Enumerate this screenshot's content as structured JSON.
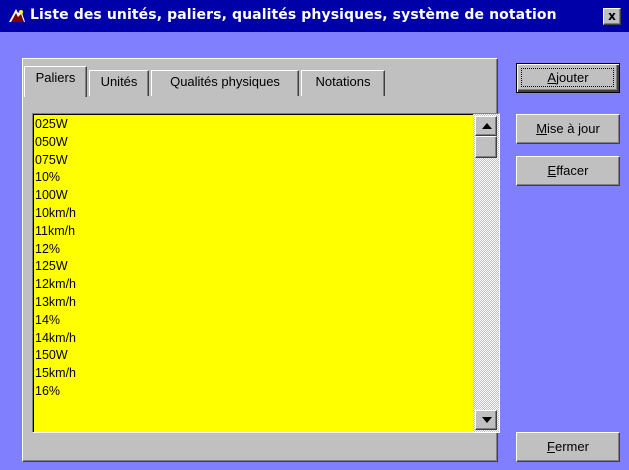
{
  "window": {
    "title": "Liste des unités, paliers, qualités physiques, système de notation",
    "close_label": "x"
  },
  "tabs": [
    {
      "label": "Paliers",
      "active": true
    },
    {
      "label": "Unités",
      "active": false
    },
    {
      "label": "Qualités physiques",
      "active": false
    },
    {
      "label": "Notations",
      "active": false
    }
  ],
  "list": {
    "background_color": "#ffff00",
    "items": [
      "025W",
      "050W",
      "075W",
      "10%",
      "100W",
      "10km/h",
      "11km/h",
      "12%",
      "125W",
      "12km/h",
      "13km/h",
      "14%",
      "14km/h",
      "150W",
      "15km/h",
      "16%"
    ]
  },
  "buttons": {
    "ajouter": {
      "mnemonic": "A",
      "rest": "jouter"
    },
    "mise_a_jour": {
      "mnemonic": "M",
      "rest": "ise à jour"
    },
    "effacer": {
      "mnemonic": "E",
      "rest": "ffacer"
    },
    "fermer": {
      "mnemonic": "F",
      "rest": "ermer"
    }
  },
  "icons": {
    "app": "app-icon",
    "close": "close-icon",
    "scroll_up": "scroll-up-arrow-icon",
    "scroll_down": "scroll-down-arrow-icon"
  },
  "colors": {
    "titlebar": "#0000a8",
    "background": "#8080ff",
    "face": "#c0c0c0"
  }
}
